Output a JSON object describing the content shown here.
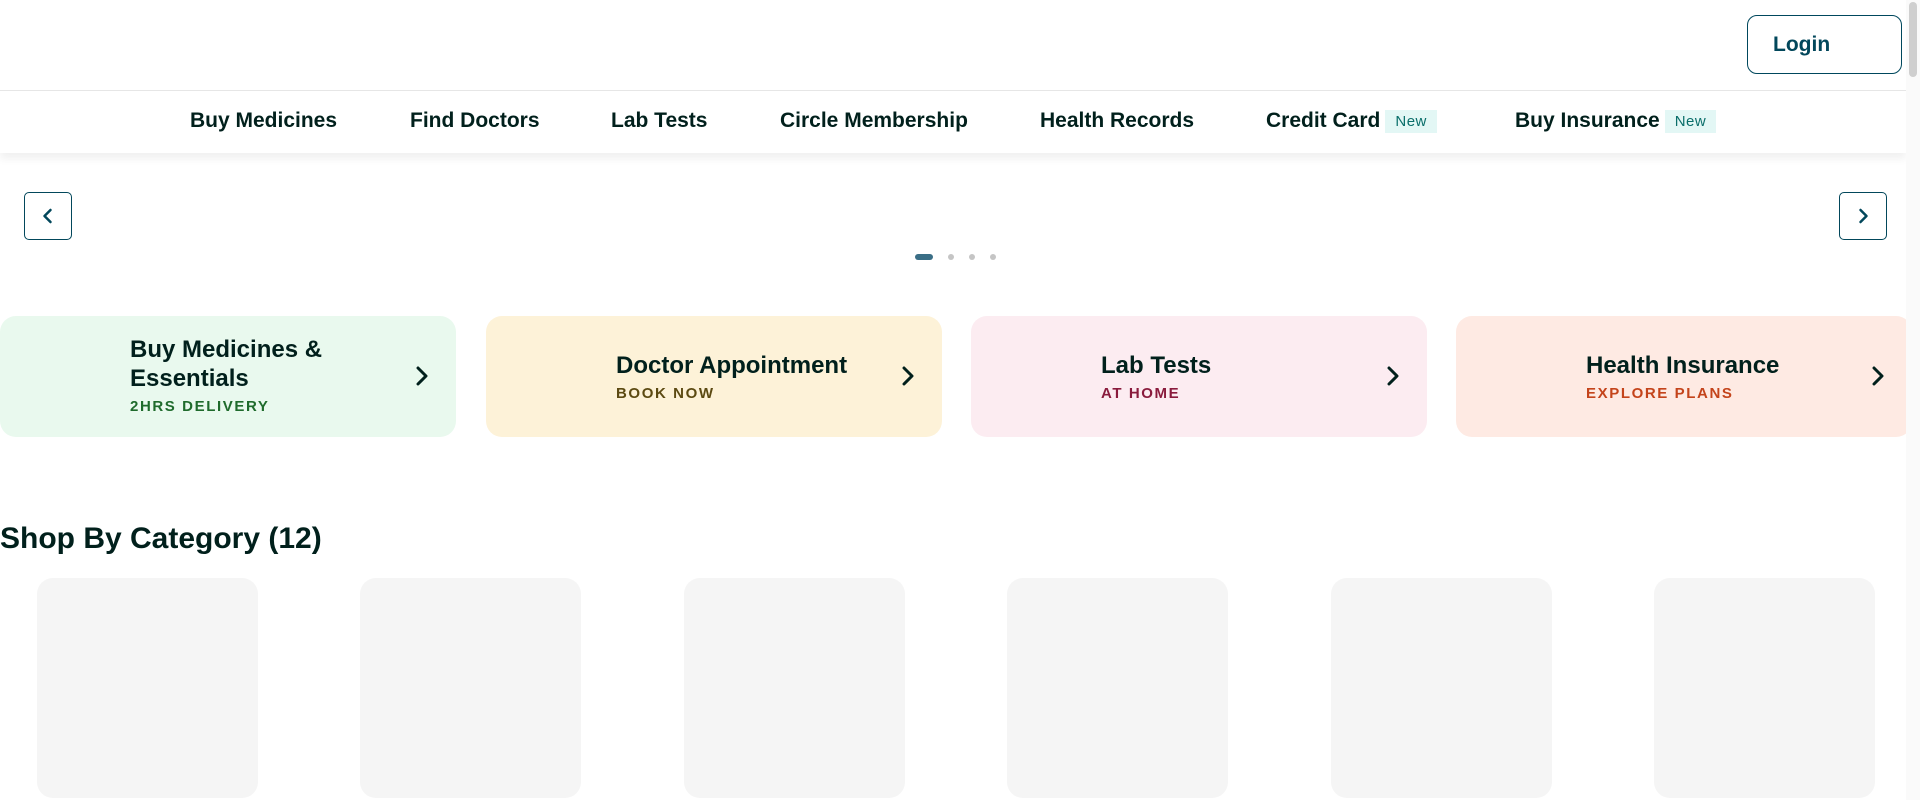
{
  "header": {
    "login_label": "Login"
  },
  "nav": {
    "items": [
      {
        "label": "Buy Medicines",
        "badge": ""
      },
      {
        "label": "Find Doctors",
        "badge": ""
      },
      {
        "label": "Lab Tests",
        "badge": ""
      },
      {
        "label": "Circle Membership",
        "badge": ""
      },
      {
        "label": "Health Records",
        "badge": ""
      },
      {
        "label": "Credit Card",
        "badge": "New"
      },
      {
        "label": "Buy Insurance",
        "badge": "New"
      }
    ]
  },
  "carousel": {
    "dot_count": 4,
    "active_index": 0,
    "prev_icon": "chevron-left-icon",
    "next_icon": "chevron-right-icon"
  },
  "services": [
    {
      "title": "Buy Medicines & Essentials",
      "subtitle": "2HRS DELIVERY",
      "bg": "#e9f9ee",
      "sub_color": "#1f6b2c"
    },
    {
      "title": "Doctor Appointment",
      "subtitle": "BOOK NOW",
      "bg": "#fdf2d8",
      "sub_color": "#5c4a12"
    },
    {
      "title": "Lab Tests",
      "subtitle": "AT HOME",
      "bg": "#fcecf1",
      "sub_color": "#8a1b3d"
    },
    {
      "title": "Health Insurance",
      "subtitle": "EXPLORE PLANS",
      "bg": "#feeae3",
      "sub_color": "#c4441b"
    }
  ],
  "category_section": {
    "title": "Shop By Category (12)"
  },
  "colors": {
    "brand": "#02475b",
    "tile": "#f5f5f5"
  }
}
